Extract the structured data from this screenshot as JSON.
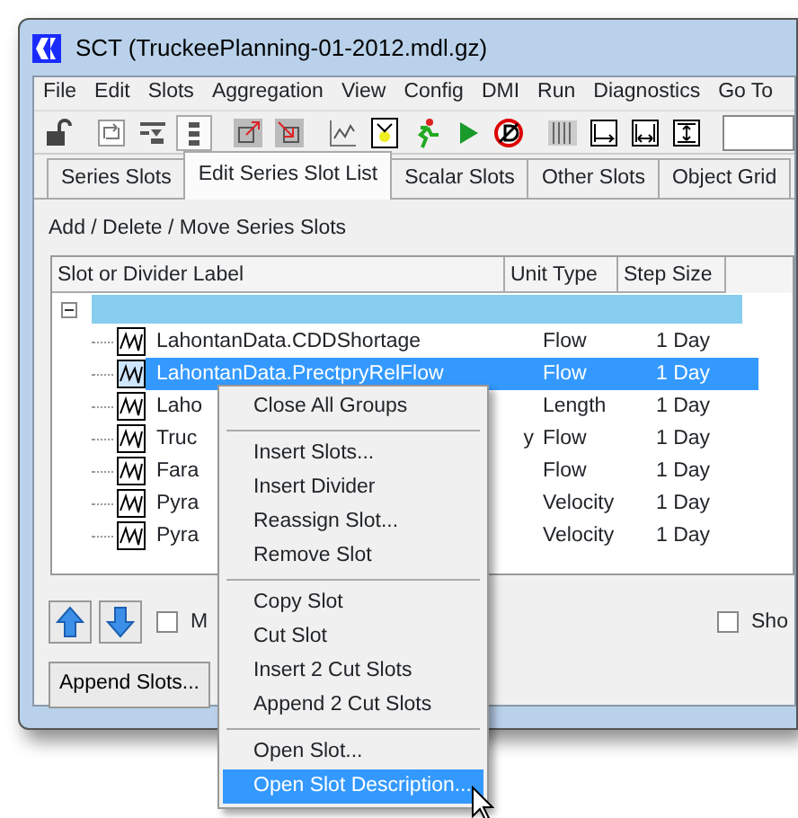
{
  "window": {
    "title": "SCT  (TruckeePlanning-01-2012.mdl.gz)"
  },
  "menu_bar": [
    "File",
    "Edit",
    "Slots",
    "Aggregation",
    "View",
    "Config",
    "DMI",
    "Run",
    "Diagnostics",
    "Go To"
  ],
  "toolbar": [
    {
      "kind": "lock"
    },
    {
      "kind": "sep"
    },
    {
      "kind": "swap"
    },
    {
      "kind": "filter"
    },
    {
      "kind": "list",
      "selected": true
    },
    {
      "kind": "sep"
    },
    {
      "kind": "arrow-out"
    },
    {
      "kind": "arrow-in"
    },
    {
      "kind": "sep"
    },
    {
      "kind": "plot"
    },
    {
      "kind": "person"
    },
    {
      "kind": "runner"
    },
    {
      "kind": "play"
    },
    {
      "kind": "stop"
    },
    {
      "kind": "sep"
    },
    {
      "kind": "columns"
    },
    {
      "kind": "width-left"
    },
    {
      "kind": "width-both"
    },
    {
      "kind": "width-fit"
    },
    {
      "kind": "sep"
    },
    {
      "kind": "field"
    }
  ],
  "tabs": [
    {
      "label": "Series Slots",
      "selected": false
    },
    {
      "label": "Edit Series Slot List",
      "selected": true
    },
    {
      "label": "Scalar Slots",
      "selected": false
    },
    {
      "label": "Other Slots",
      "selected": false
    },
    {
      "label": "Object Grid",
      "selected": false
    }
  ],
  "section_label": "Add / Delete / Move Series Slots",
  "table": {
    "columns": [
      "Slot or Divider Label",
      "Unit Type",
      "Step Size"
    ],
    "group": {
      "expanded": true
    },
    "rows": [
      {
        "label": "LahontanData.CDDShortage",
        "unit_type": "Flow",
        "step_size": "1 Day",
        "selected": false
      },
      {
        "label": "LahontanData.PrectpryRelFlow",
        "unit_type": "Flow",
        "step_size": "1 Day",
        "selected": true
      },
      {
        "label": "Laho",
        "unit_type": "Length",
        "step_size": "1 Day",
        "selected": false
      },
      {
        "label": "Truc",
        "label_tail": "y",
        "unit_type": "Flow",
        "step_size": "1 Day",
        "selected": false
      },
      {
        "label": "Fara",
        "unit_type": "Flow",
        "step_size": "1 Day",
        "selected": false
      },
      {
        "label": "Pyra",
        "unit_type": "Velocity",
        "step_size": "1 Day",
        "selected": false
      },
      {
        "label": "Pyra",
        "unit_type": "Velocity",
        "step_size": "1 Day",
        "selected": false
      }
    ]
  },
  "move_checkbox": {
    "label": "M",
    "checked": false
  },
  "show_checkbox": {
    "label": "Sho",
    "checked": false
  },
  "append_button": "Append Slots...",
  "context_menu": [
    {
      "kind": "item",
      "label": "Close All Groups",
      "selected": false
    },
    {
      "kind": "separator"
    },
    {
      "kind": "item",
      "label": "Insert Slots...",
      "selected": false
    },
    {
      "kind": "item",
      "label": "Insert Divider",
      "selected": false
    },
    {
      "kind": "item",
      "label": "Reassign Slot...",
      "selected": false
    },
    {
      "kind": "item",
      "label": "Remove Slot",
      "selected": false
    },
    {
      "kind": "separator"
    },
    {
      "kind": "item",
      "label": "Copy Slot",
      "selected": false
    },
    {
      "kind": "item",
      "label": "Cut Slot",
      "selected": false
    },
    {
      "kind": "item",
      "label": "Insert 2 Cut Slots",
      "selected": false
    },
    {
      "kind": "item",
      "label": "Append 2 Cut Slots",
      "selected": false
    },
    {
      "kind": "separator"
    },
    {
      "kind": "item",
      "label": "Open Slot...",
      "selected": false
    },
    {
      "kind": "item",
      "label": "Open Slot Description...",
      "selected": true
    }
  ]
}
